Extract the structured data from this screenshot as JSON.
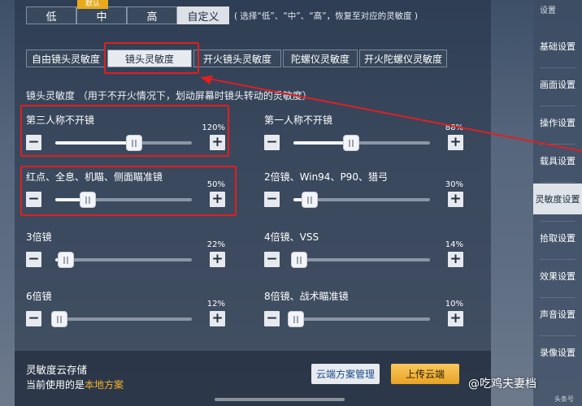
{
  "presets": {
    "badge": "默认",
    "items": [
      {
        "label": "低",
        "active": false
      },
      {
        "label": "中",
        "active": false
      },
      {
        "label": "高",
        "active": false
      },
      {
        "label": "自定义",
        "active": true
      }
    ],
    "hint": "( 选择“低”、“中”、“高”，恢复至对应的灵敏度 )"
  },
  "tabs": [
    {
      "label": "自由镜头灵敏度",
      "active": false
    },
    {
      "label": "镜头灵敏度",
      "active": true
    },
    {
      "label": "开火镜头灵敏度",
      "active": false
    },
    {
      "label": "陀螺仪灵敏度",
      "active": false
    },
    {
      "label": "开火陀螺仪灵敏度",
      "active": false
    }
  ],
  "section_title": "镜头灵敏度  （用于不开火情况下，划动屏幕时镜头转动的灵敏度）",
  "sliders": [
    {
      "label": "第三人称不开镜",
      "value": "120%",
      "fraction": 0.58,
      "highlight": true
    },
    {
      "label": "第一人称不开镜",
      "value": "88%",
      "fraction": 0.42,
      "highlight": false
    },
    {
      "label": "红点、全息、机瞄、侧面瞄准镜",
      "value": "50%",
      "fraction": 0.24,
      "highlight": true
    },
    {
      "label": "2倍镜、Win94、P90、猎弓",
      "value": "30%",
      "fraction": 0.12,
      "highlight": false
    },
    {
      "label": "3倍镜",
      "value": "22%",
      "fraction": 0.08,
      "highlight": false
    },
    {
      "label": "4倍镜、VSS",
      "value": "14%",
      "fraction": 0.04,
      "highlight": false
    },
    {
      "label": "6倍镜",
      "value": "12%",
      "fraction": 0.03,
      "highlight": false
    },
    {
      "label": "8倍镜、战术瞄准镜",
      "value": "10%",
      "fraction": 0.02,
      "highlight": false
    }
  ],
  "minus_label": "−",
  "plus_label": "+",
  "cloud": {
    "title": "灵敏度云存储",
    "current_prefix": "当前使用的是",
    "current_value": "本地方案",
    "manage_label": "云端方案管理",
    "upload_label": "上传云端"
  },
  "sidebar": {
    "header": "设置",
    "items": [
      {
        "label": "基础设置",
        "active": false
      },
      {
        "label": "画面设置",
        "active": false
      },
      {
        "label": "操作设置",
        "active": false
      },
      {
        "label": "载具设置",
        "active": false
      },
      {
        "label": "灵敏度设置",
        "active": true
      },
      {
        "label": "拾取设置",
        "active": false
      },
      {
        "label": "效果设置",
        "active": false
      },
      {
        "label": "声音设置",
        "active": false
      },
      {
        "label": "录像设置",
        "active": false
      }
    ]
  },
  "watermark": "@吃鸡夫妻档",
  "watermark_sub": "头条号"
}
